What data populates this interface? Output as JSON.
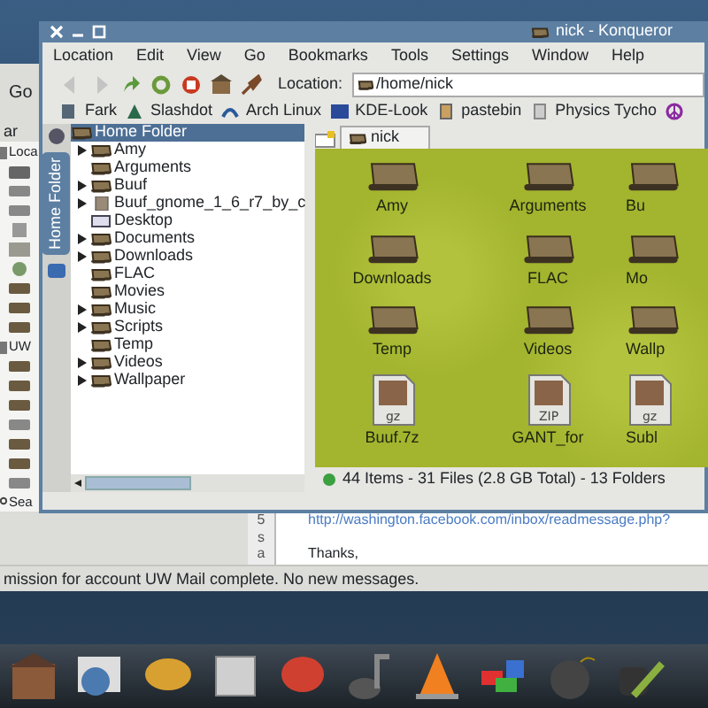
{
  "mail_window": {
    "menu_fragment": "Go",
    "toolbar_fragment": "ar",
    "accounts": [
      {
        "label": "Loca",
        "folders": [
          {
            "kind": "inbox"
          },
          {
            "kind": "drive"
          },
          {
            "kind": "drive"
          },
          {
            "kind": "trash"
          },
          {
            "kind": "photo"
          },
          {
            "kind": "globe"
          },
          {
            "kind": "folder"
          },
          {
            "kind": "folder"
          },
          {
            "kind": "folder"
          }
        ]
      },
      {
        "label": "UW",
        "folders": [
          {
            "kind": "folder"
          },
          {
            "kind": "folder"
          },
          {
            "kind": "folder"
          },
          {
            "kind": "drive"
          },
          {
            "kind": "folder"
          },
          {
            "kind": "folder"
          },
          {
            "kind": "drive"
          }
        ]
      }
    ],
    "search_label": "Sea",
    "gutter": [
      "5",
      "s",
      "a"
    ],
    "message_lines": [
      {
        "kind": "link",
        "text": "http://washington.facebook.com/inbox/readmessage.php?"
      },
      {
        "kind": "text",
        "text": "Thanks,"
      }
    ],
    "status_bar": "mission for account UW Mail complete. No new messages."
  },
  "konqueror": {
    "title": "nick - Konqueror",
    "menu": [
      "Location",
      "Edit",
      "View",
      "Go",
      "Bookmarks",
      "Tools",
      "Settings",
      "Window",
      "Help"
    ],
    "toolbar": [
      {
        "kind": "back",
        "disabled": true
      },
      {
        "kind": "forward",
        "disabled": true
      },
      {
        "kind": "up",
        "disabled": false
      },
      {
        "kind": "reload",
        "disabled": false
      },
      {
        "kind": "stop",
        "disabled": false
      },
      {
        "kind": "home",
        "disabled": false
      },
      {
        "kind": "clear",
        "disabled": false
      }
    ],
    "location_label": "Location:",
    "location_value": "/home/nick",
    "bookmarks": [
      {
        "kind": "news",
        "label": "Fark"
      },
      {
        "kind": "slash",
        "label": "Slashdot"
      },
      {
        "kind": "arch",
        "label": "Arch Linux"
      },
      {
        "kind": "kde",
        "label": "KDE-Look"
      },
      {
        "kind": "clip",
        "label": "pastebin"
      },
      {
        "kind": "page",
        "label": "Physics Tycho"
      },
      {
        "kind": "peace"
      }
    ],
    "sidebar_tabs": [
      {
        "label": "Home Folder",
        "selected": true
      }
    ],
    "tree": {
      "label": "Home Folder",
      "selected": true,
      "children": [
        {
          "label": "Amy",
          "kind": "folder",
          "expandable": true
        },
        {
          "label": "Arguments",
          "kind": "folder",
          "expandable": false
        },
        {
          "label": "Buuf",
          "kind": "folder",
          "expandable": true
        },
        {
          "label": "Buuf_gnome_1_6_r7_by_c",
          "kind": "file",
          "expandable": true
        },
        {
          "label": "Desktop",
          "kind": "desktop",
          "expandable": false
        },
        {
          "label": "Documents",
          "kind": "folder",
          "expandable": true
        },
        {
          "label": "Downloads",
          "kind": "folder",
          "expandable": true
        },
        {
          "label": "FLAC",
          "kind": "folder",
          "expandable": false
        },
        {
          "label": "Movies",
          "kind": "folder",
          "expandable": false
        },
        {
          "label": "Music",
          "kind": "folder",
          "expandable": true
        },
        {
          "label": "Scripts",
          "kind": "folder",
          "expandable": true
        },
        {
          "label": "Temp",
          "kind": "folder",
          "expandable": false
        },
        {
          "label": "Videos",
          "kind": "folder",
          "expandable": true
        },
        {
          "label": "Wallpaper",
          "kind": "folder",
          "expandable": true
        }
      ]
    },
    "view_tabs": [
      {
        "label": "nick",
        "selected": true
      }
    ],
    "icons": [
      {
        "kind": "folder",
        "label": "Amy"
      },
      {
        "kind": "folder",
        "label": "Arguments"
      },
      {
        "kind": "folder",
        "label": "Bu"
      },
      {
        "kind": "folder",
        "label": "Downloads"
      },
      {
        "kind": "folder",
        "label": "FLAC"
      },
      {
        "kind": "folder",
        "label": "Mo"
      },
      {
        "kind": "folder",
        "label": "Temp"
      },
      {
        "kind": "folder",
        "label": "Videos"
      },
      {
        "kind": "folder",
        "label": "Wallp"
      },
      {
        "kind": "archive",
        "badge": "gz",
        "label": "Buuf.7z"
      },
      {
        "kind": "archive",
        "badge": "ZIP",
        "label": "GANT_for"
      },
      {
        "kind": "archive",
        "badge": "gz",
        "label": "Subl"
      }
    ],
    "status_bar": "44 Items - 31 Files (2.8 GB Total) - 13 Folders"
  },
  "dock": [
    {
      "kind": "home"
    },
    {
      "kind": "newspaper"
    },
    {
      "kind": "chat"
    },
    {
      "kind": "papers"
    },
    {
      "kind": "messenger"
    },
    {
      "kind": "music"
    },
    {
      "kind": "cone"
    },
    {
      "kind": "blocks"
    },
    {
      "kind": "bomb"
    },
    {
      "kind": "ink"
    }
  ]
}
